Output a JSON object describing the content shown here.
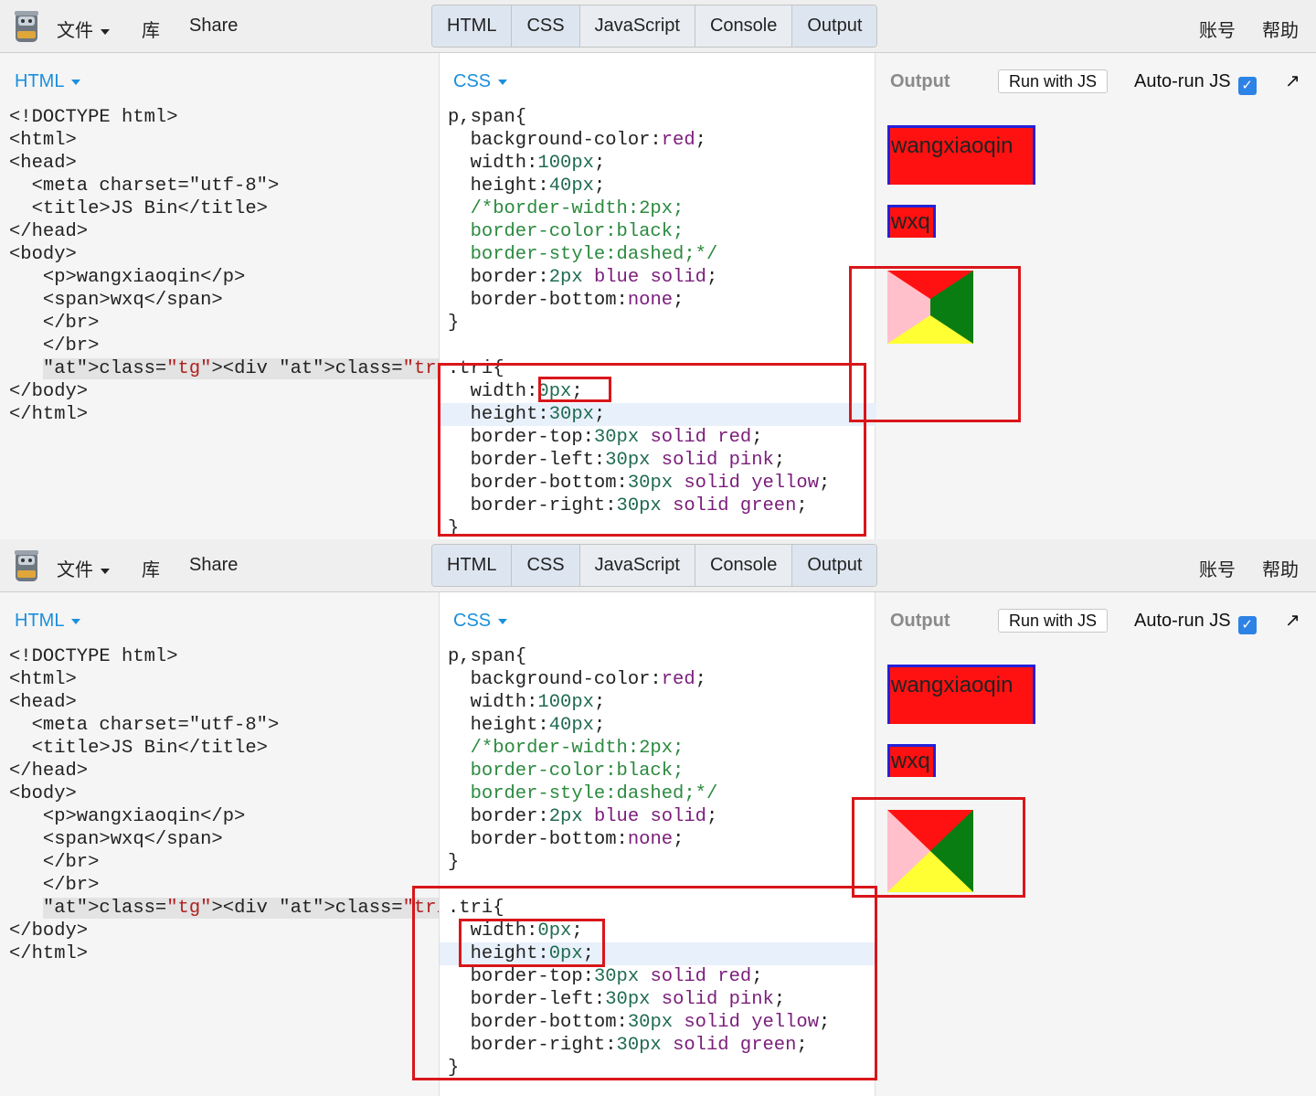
{
  "app": {
    "menu": {
      "file": "文件",
      "library": "库",
      "share": "Share"
    },
    "tabs": [
      "HTML",
      "CSS",
      "JavaScript",
      "Console",
      "Output"
    ],
    "right": {
      "account": "账号",
      "help": "帮助"
    },
    "panels": {
      "html_title": "HTML",
      "css_title": "CSS",
      "output_title": "Output"
    },
    "output_controls": {
      "run_label": "Run with JS",
      "autorun_label": "Auto-run JS",
      "autorun_checked": true,
      "popout": "↗"
    }
  },
  "html_code": [
    "<!DOCTYPE html>",
    "<html>",
    "<head>",
    "  <meta charset=\"utf-8\">",
    "  <title>JS Bin</title>",
    "</head>",
    "<body>",
    "   <p>wangxiaoqin</p>",
    "   <span>wxq</span>",
    "   </br>",
    "   </br>",
    "   <div class=\"tri\"></div>",
    "</body>",
    "</html>"
  ],
  "shots": [
    {
      "css_code": [
        "p,span{",
        "  background-color:red;",
        "  width:100px;",
        "  height:40px;",
        "  /*border-width:2px;",
        "  border-color:black;",
        "  border-style:dashed;*/",
        "  border:2px blue solid;",
        "  border-bottom:none;",
        "}",
        "",
        ".tri{",
        "  width:0px;",
        "  height:30px;",
        "  border-top:30px solid red;",
        "  border-left:30px solid pink;",
        "  border-bottom:30px solid yellow;",
        "  border-right:30px solid green;",
        "}"
      ],
      "output": {
        "p_text": "wangxiaoqin",
        "span_text": "wxq"
      }
    },
    {
      "css_code": [
        "p,span{",
        "  background-color:red;",
        "  width:100px;",
        "  height:40px;",
        "  /*border-width:2px;",
        "  border-color:black;",
        "  border-style:dashed;*/",
        "  border:2px blue solid;",
        "  border-bottom:none;",
        "}",
        "",
        ".tri{",
        "  width:0px;",
        "  height:0px;",
        "  border-top:30px solid red;",
        "  border-left:30px solid pink;",
        "  border-bottom:30px solid yellow;",
        "  border-right:30px solid green;",
        "}"
      ],
      "output": {
        "p_text": "wangxiaoqin",
        "span_text": "wxq"
      }
    }
  ],
  "colors": {
    "annotation": "#d9161a",
    "accent": "#1b8fdc",
    "p_bg": "#ff1111",
    "p_border": "#2320d8"
  }
}
